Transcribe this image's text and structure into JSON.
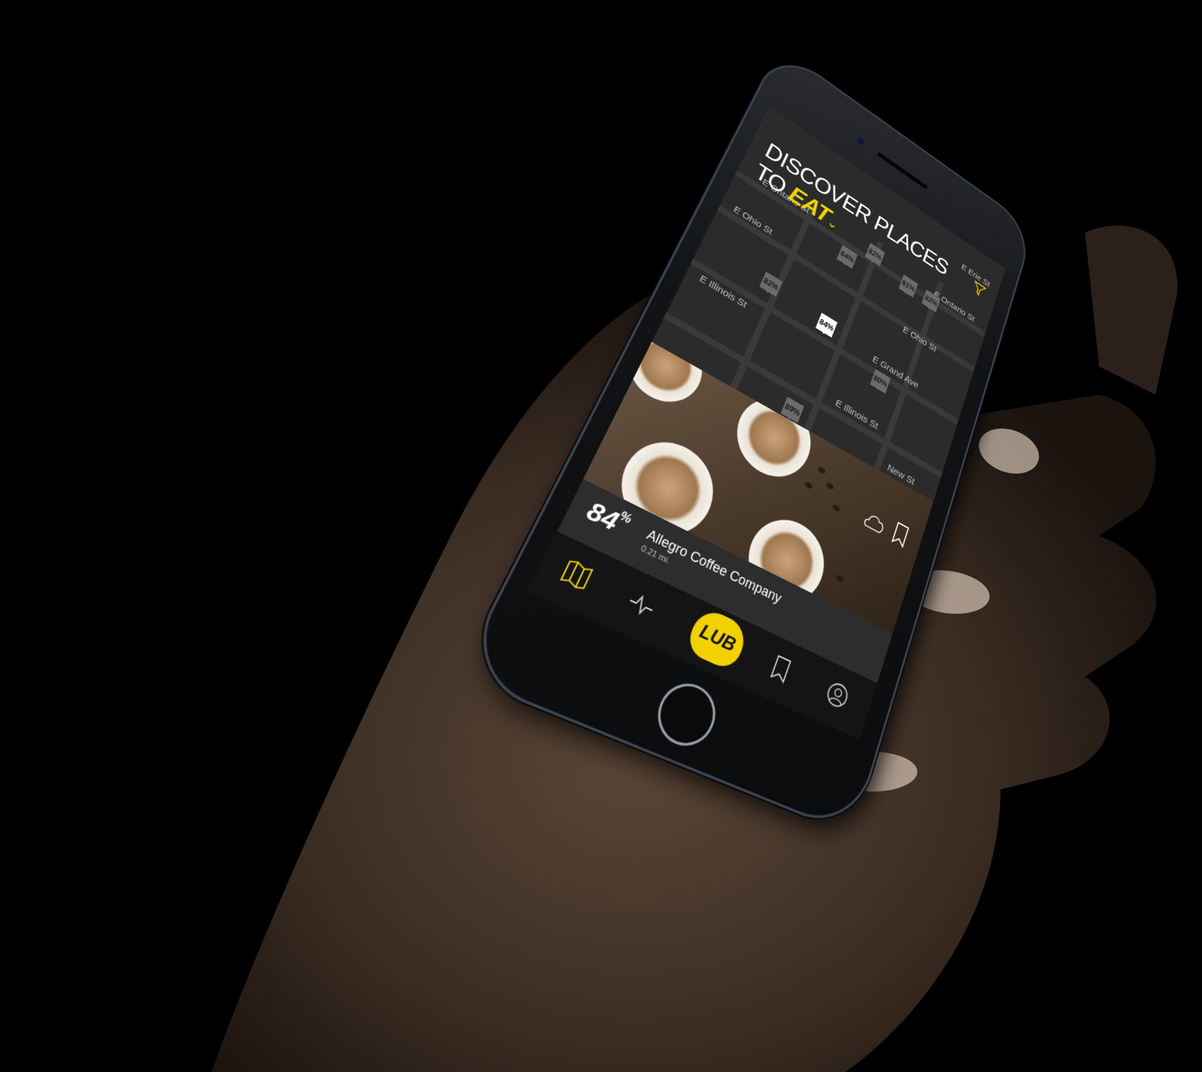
{
  "header": {
    "title_line1": "DISCOVER PLACES",
    "title_line2_prefix": "TO ",
    "title_highlight": "EAT",
    "dropdown_icon": "chevron-down-icon",
    "filter_icon": "filter-icon"
  },
  "map": {
    "streets": [
      "E Ontario St",
      "E Ohio St",
      "E Ohio St",
      "E Grand Ave",
      "E Illinois St",
      "E Illinois St",
      "E Ontario St",
      "E Erie St",
      "New St"
    ],
    "pins": [
      "82%",
      "84%",
      "81%",
      "82%",
      "82%",
      "84%",
      "80%",
      "89%"
    ]
  },
  "card": {
    "score": "84",
    "score_unit": "%",
    "name": "Allegro Coffee Company",
    "distance": "0.21 mi.",
    "logo_icon": "lub-logo-icon",
    "bookmark_icon": "bookmark-icon"
  },
  "tabbar": {
    "tabs": [
      "map-icon",
      "activity-icon",
      "lub-icon",
      "bookmark-icon",
      "profile-icon"
    ],
    "center_label": "LUB"
  },
  "colors": {
    "accent": "#f2d100",
    "background": "#2b2b2b",
    "tabbar": "#141414"
  }
}
